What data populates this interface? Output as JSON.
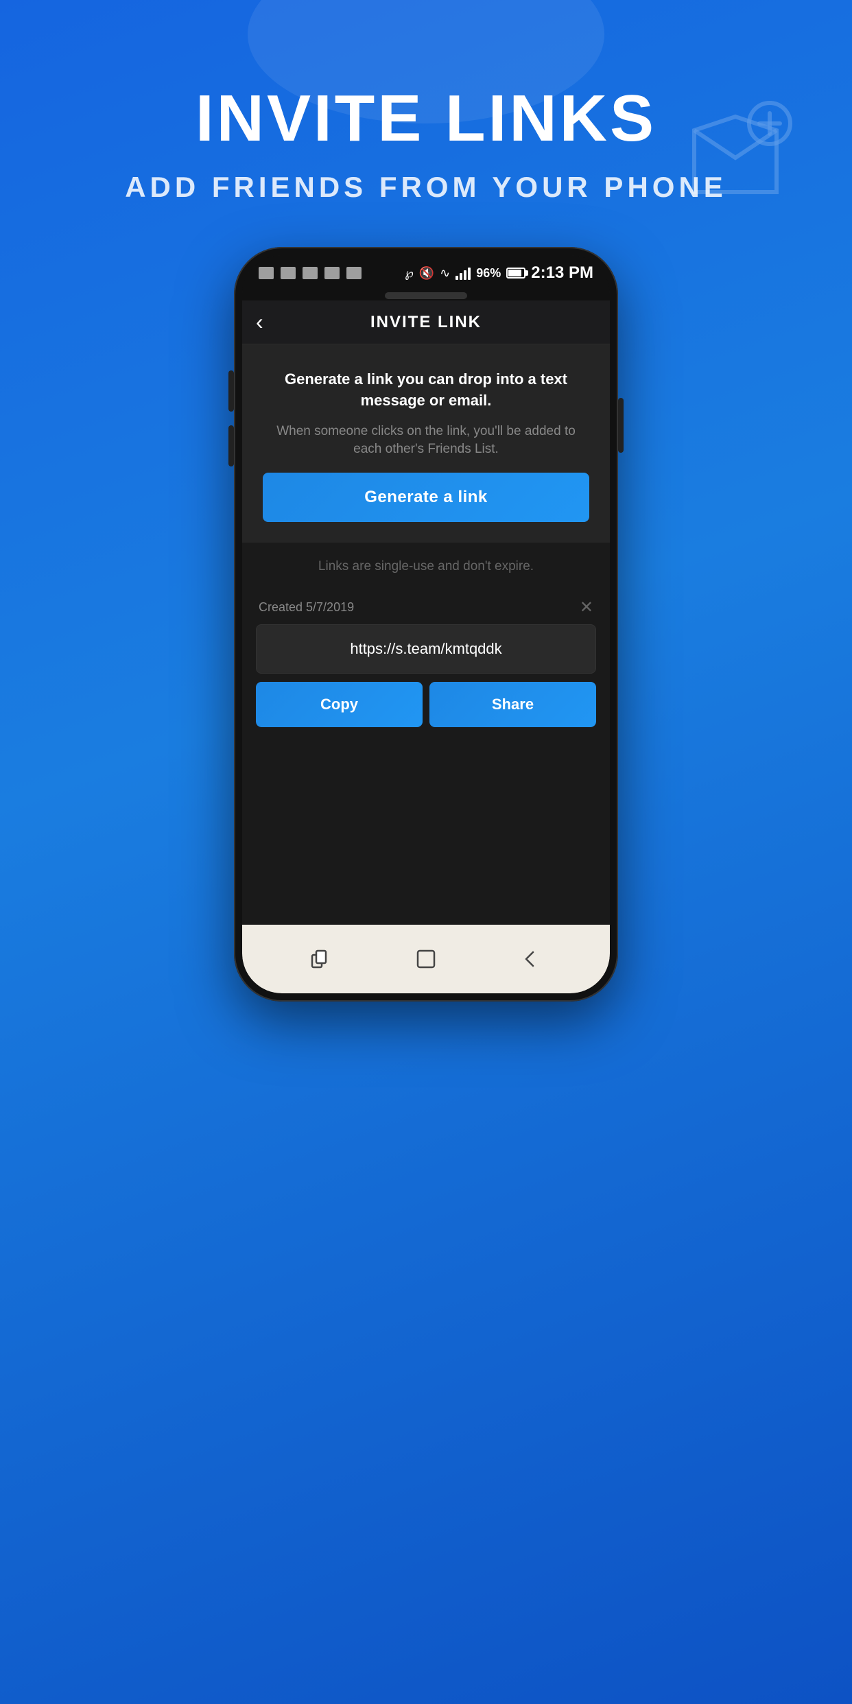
{
  "page": {
    "background_color": "#1565e0"
  },
  "header": {
    "title": "INVITE LINKS",
    "subtitle": "ADD FRIENDS FROM YOUR PHONE"
  },
  "phone": {
    "status_bar": {
      "time": "2:13 PM",
      "battery_percent": "96%",
      "icons": [
        "bluetooth",
        "mute",
        "wifi",
        "signal"
      ]
    },
    "app": {
      "header_title": "INVITE LINK",
      "back_button": "‹",
      "info_main_text": "Generate a link you can drop into a text message or email.",
      "info_sub_text": "When someone clicks on the link, you'll be added to each other's Friends List.",
      "generate_button_label": "Generate a link",
      "single_use_text": "Links are single-use and don't expire.",
      "link_card": {
        "created_label": "Created 5/7/2019",
        "link_url": "https://s.team/kmtqddk",
        "copy_button_label": "Copy",
        "share_button_label": "Share"
      }
    },
    "bottom_nav": {
      "icons": [
        "recent-apps",
        "home",
        "back"
      ]
    }
  }
}
